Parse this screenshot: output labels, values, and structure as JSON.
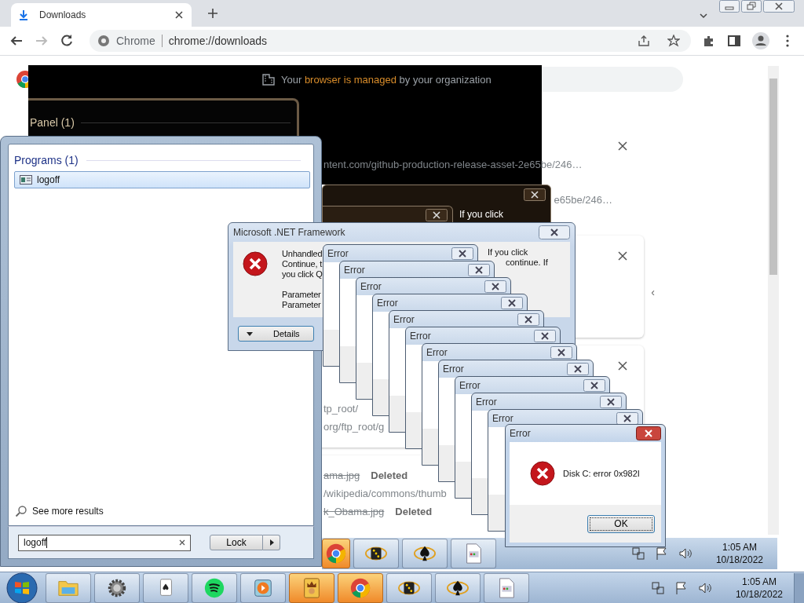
{
  "browser": {
    "tab": {
      "title": "Downloads"
    },
    "omnibox": {
      "site": "Chrome",
      "url": "chrome://downloads"
    }
  },
  "managed_notice": {
    "before": "Your",
    "link": "browser is managed",
    "after": "by your organization"
  },
  "dark_panel": {
    "title": "Panel (1)"
  },
  "dark_dialog": {
    "text": "If you click"
  },
  "downloads": {
    "cards": [
      {
        "lines": [
          {
            "kind": "url",
            "text": "ntent.com/github-production-release-asset-2e65be/246…"
          },
          {
            "kind": "url-right",
            "text": "e65be/246…"
          }
        ]
      },
      {
        "lines": [
          {
            "kind": "blank",
            "text": "‹"
          }
        ]
      },
      {
        "lines": [
          {
            "kind": "url",
            "text": "tp_root/"
          },
          {
            "kind": "url",
            "text": "org/ftp_root/g"
          }
        ]
      },
      {
        "lines": [
          {
            "kind": "file",
            "text": "ama.jpg",
            "status": "Deleted"
          },
          {
            "kind": "url",
            "text": "/wikipedia/commons/thumb"
          },
          {
            "kind": "file",
            "text": "k_Obama.jpg",
            "status": "Deleted"
          }
        ]
      }
    ]
  },
  "net_dialog": {
    "title": "Microsoft .NET Framework",
    "paragraphs": [
      [
        "Unhandled",
        "Continue, t",
        "you click Q"
      ],
      [
        "Parameter",
        "Parameter"
      ]
    ],
    "side_lines": [
      "If you click",
      "continue. If"
    ],
    "details_button": "Details"
  },
  "error_cascade": [
    {
      "title": "Error"
    },
    {
      "title": "Error"
    },
    {
      "title": "Error"
    },
    {
      "title": "Error"
    },
    {
      "title": "Error"
    },
    {
      "title": "Error"
    },
    {
      "title": "Error"
    },
    {
      "title": "Error"
    },
    {
      "title": "Error"
    },
    {
      "title": "Error"
    },
    {
      "title": "Error"
    }
  ],
  "error_dialog": {
    "title": "Error",
    "message": "Disk C: error 0x982I",
    "button": "OK"
  },
  "start_menu": {
    "section": "Programs (1)",
    "results": [
      {
        "label": "logoff",
        "selected": true
      }
    ],
    "see_more": "See more results",
    "search": {
      "value": "logoff"
    },
    "power_button": "Lock"
  },
  "ghost_taskbar": {
    "apps": [
      {
        "kind": "chrome",
        "flashing": true
      },
      {
        "kind": "dice",
        "flashing": false
      },
      {
        "kind": "spade",
        "flashing": false
      },
      {
        "kind": "document",
        "flashing": false
      }
    ],
    "clock": {
      "time": "1:05 AM",
      "date": "10/18/2022"
    }
  },
  "taskbar": {
    "apps": [
      {
        "kind": "folder",
        "flashing": false
      },
      {
        "kind": "gear",
        "flashing": false
      },
      {
        "kind": "cards",
        "flashing": false
      },
      {
        "kind": "spotify",
        "flashing": false
      },
      {
        "kind": "media",
        "flashing": false
      },
      {
        "kind": "king",
        "flashing": true
      },
      {
        "kind": "chrome",
        "flashing": true
      },
      {
        "kind": "dice",
        "flashing": false
      },
      {
        "kind": "spade",
        "flashing": false
      },
      {
        "kind": "document",
        "flashing": false
      }
    ],
    "clock": {
      "time": "1:05 AM",
      "date": "10/18/2022"
    }
  }
}
